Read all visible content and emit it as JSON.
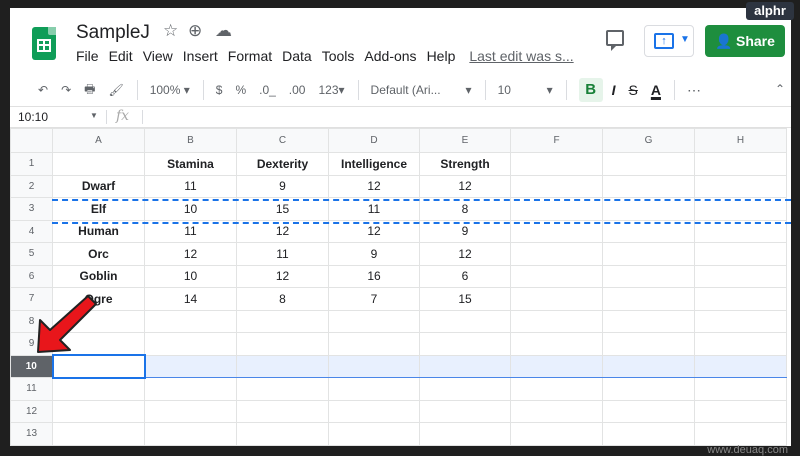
{
  "watermark": "alphr",
  "footer_watermark": "www.deuaq.com",
  "title_bar": {
    "doc_title": "SampleJ",
    "icons": [
      "star-icon",
      "move-to-folder-icon",
      "cloud-status-icon"
    ]
  },
  "menu": {
    "items": [
      "File",
      "Edit",
      "View",
      "Insert",
      "Format",
      "Data",
      "Tools",
      "Add-ons",
      "Help"
    ],
    "last_edit": "Last edit was s..."
  },
  "header_actions": {
    "share_label": "Share",
    "share_icon": "person-lock-icon"
  },
  "toolbar": {
    "zoom": "100%",
    "currency": "$",
    "percent": "%",
    "decrease_decimals": ".0_",
    "increase_decimals": ".00",
    "more_formats": "123",
    "font": "Default (Ari...",
    "font_size": "10",
    "bold": "B",
    "italic": "I",
    "strikethrough": "S",
    "text_color": "A",
    "more": "⋯"
  },
  "formula_bar": {
    "name_box": "10:10",
    "fx": "fx",
    "value": ""
  },
  "sheet": {
    "columns": [
      "A",
      "B",
      "C",
      "D",
      "E",
      "F",
      "G",
      "H"
    ],
    "row_numbers": [
      "1",
      "2",
      "3",
      "4",
      "5",
      "6",
      "7",
      "8",
      "9",
      "10",
      "11",
      "12",
      "13"
    ],
    "selected_row": "10",
    "headers": [
      "",
      "Stamina",
      "Dexterity",
      "Intelligence",
      "Strength"
    ],
    "rows": [
      [
        "Dwarf",
        "11",
        "9",
        "12",
        "12"
      ],
      [
        "Elf",
        "10",
        "15",
        "11",
        "8"
      ],
      [
        "Human",
        "11",
        "12",
        "12",
        "9"
      ],
      [
        "Orc",
        "12",
        "11",
        "9",
        "12"
      ],
      [
        "Goblin",
        "10",
        "12",
        "16",
        "6"
      ],
      [
        "Ogre",
        "14",
        "8",
        "7",
        "15"
      ]
    ]
  },
  "colors": {
    "accent": "#1a73e8",
    "share_green": "#1e8e3e",
    "arrow_red": "#e8161b",
    "selected_row_fill": "#e8f0fe"
  }
}
